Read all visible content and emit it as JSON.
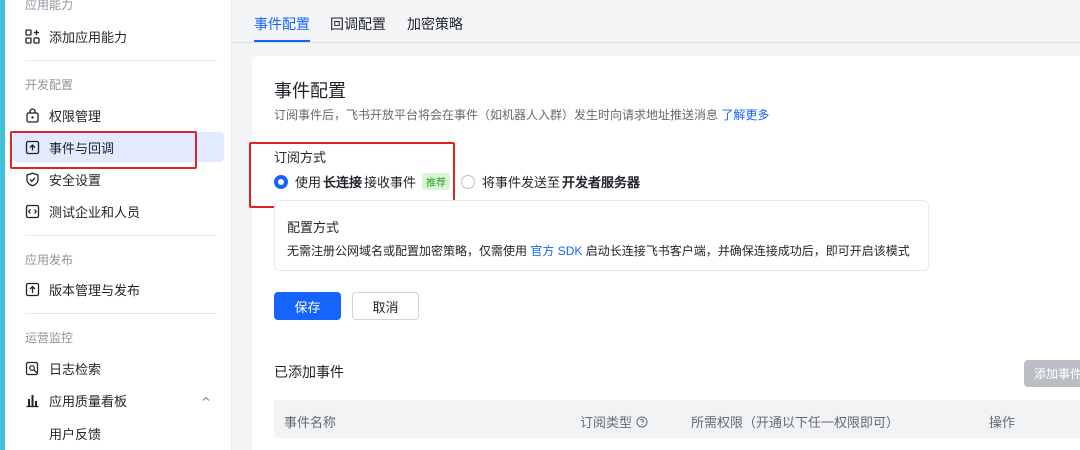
{
  "sidebar": {
    "top_partial_label": "应用能力",
    "add_capability": "添加应用能力",
    "sections": {
      "dev_config": "开发配置",
      "app_release": "应用发布",
      "ops_monitor": "运营监控"
    },
    "items": {
      "permissions": "权限管理",
      "events": "事件与回调",
      "security": "安全设置",
      "test_users": "测试企业和人员",
      "versions": "版本管理与发布",
      "logs": "日志检索",
      "quality": "应用质量看板",
      "feedback": "用户反馈"
    }
  },
  "tabs": [
    "事件配置",
    "回调配置",
    "加密策略"
  ],
  "main": {
    "title": "事件配置",
    "desc_text": "订阅事件后，飞书开放平台将会在事件（如机器人入群）发生时向请求地址推送消息",
    "desc_link": "了解更多",
    "subscribe_label": "订阅方式",
    "option1": {
      "prefix": "使用",
      "strong": "长连接",
      "suffix": "接收事件",
      "tag": "推荐"
    },
    "option2": {
      "prefix": "将事件发送至",
      "strong": "开发者服务器"
    },
    "config_box": {
      "title": "配置方式",
      "text_before": "无需注册公网域名或配置加密策略，仅需使用",
      "link": "官方 SDK",
      "text_after": "启动长连接飞书客户端，并确保连接成功后，即可开启该模式"
    },
    "save_label": "保存",
    "cancel_label": "取消",
    "added_events_title": "已添加事件",
    "add_event_button": "添加事件",
    "table_headers": {
      "name": "事件名称",
      "type": "订阅类型",
      "perm": "所需权限（开通以下任一权限即可）",
      "op": "操作"
    }
  },
  "colors": {
    "primary": "#1664ff",
    "active_bg": "#e1eaff",
    "annotation_red": "#e02424",
    "tag_green": "#2ea121"
  }
}
